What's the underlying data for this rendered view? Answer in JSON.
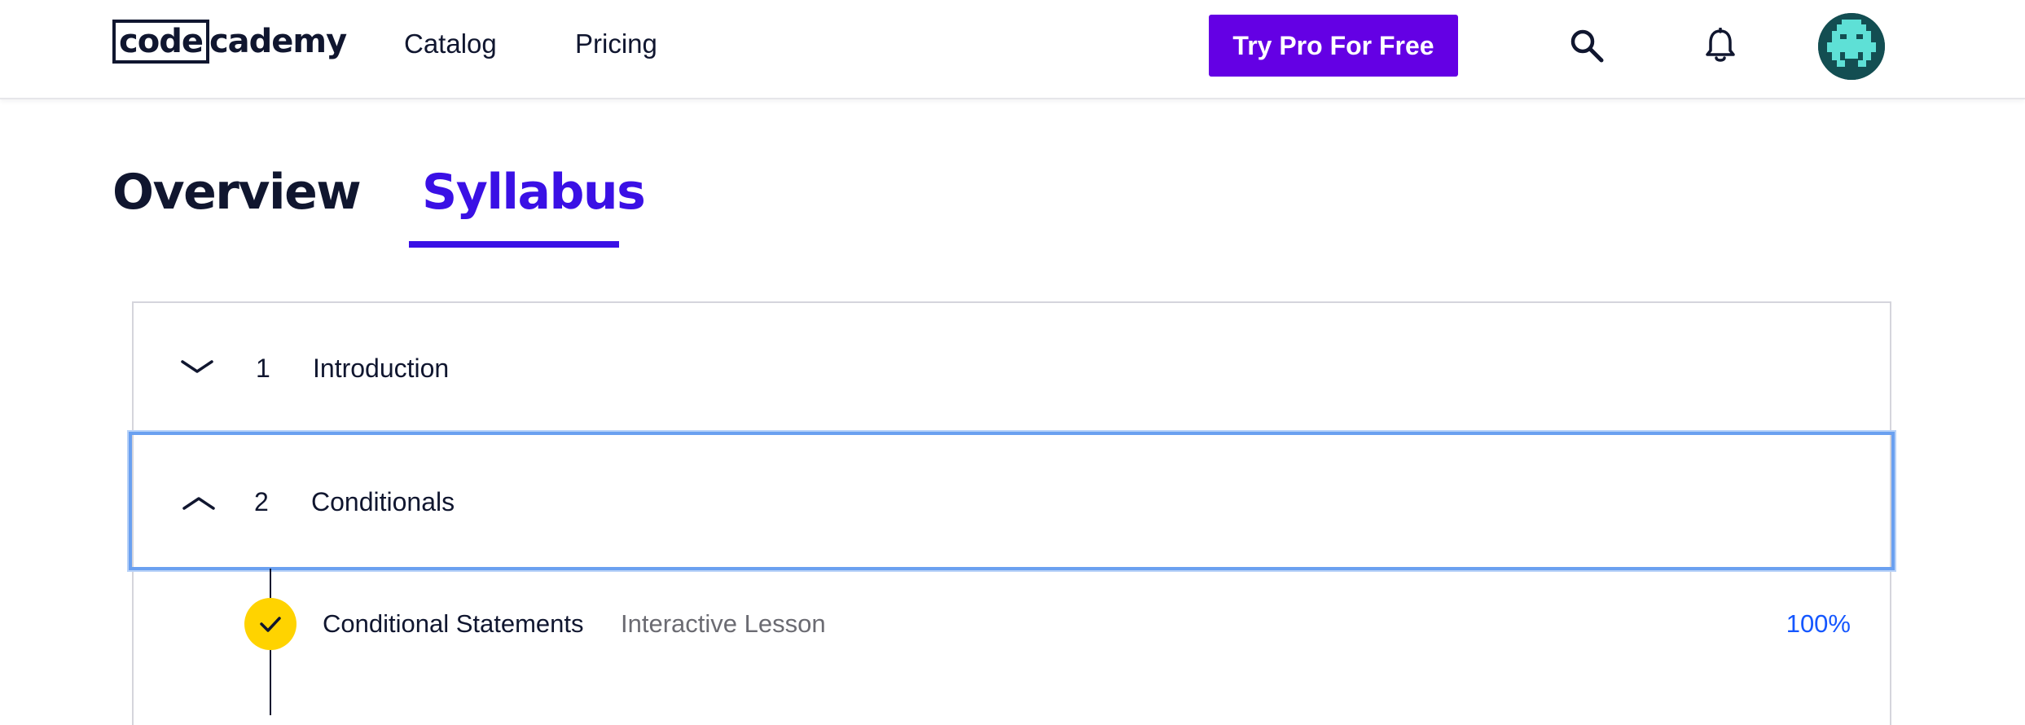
{
  "header": {
    "logo_part1": "code",
    "logo_part2": "cademy",
    "nav": {
      "catalog": "Catalog",
      "pricing": "Pricing"
    },
    "cta_label": "Try Pro For Free",
    "icons": {
      "search": "search-icon",
      "notifications": "bell-icon",
      "avatar": "pixel-avatar-icon"
    }
  },
  "tabs": [
    {
      "label": "Overview",
      "active": false
    },
    {
      "label": "Syllabus",
      "active": true
    }
  ],
  "syllabus": {
    "modules": [
      {
        "number": "1",
        "title": "Introduction",
        "expanded": false,
        "chevron": "chevron-down-icon"
      },
      {
        "number": "2",
        "title": "Conditionals",
        "expanded": true,
        "chevron": "chevron-up-icon"
      }
    ],
    "lessons": [
      {
        "title": "Conditional Statements",
        "type": "Interactive Lesson",
        "progress": "100%",
        "completed": true,
        "icon": "checkmark-icon"
      }
    ]
  },
  "colors": {
    "brand_purple": "#6400e4",
    "active_tab": "#3a10e5",
    "progress_blue": "#1557ff",
    "check_yellow": "#ffd300",
    "focus_ring": "#6aa0f0",
    "text_dark": "#10162f"
  }
}
